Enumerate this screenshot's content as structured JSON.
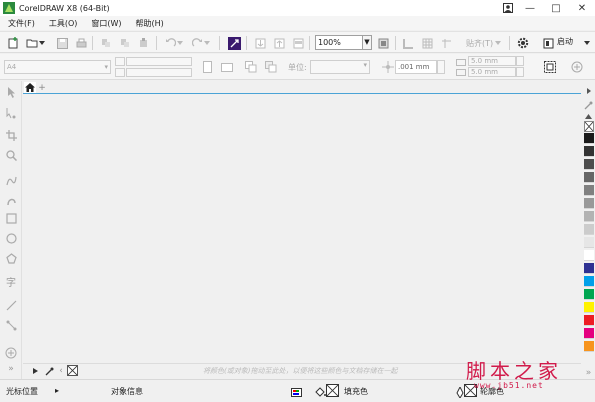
{
  "window": {
    "title": "CorelDRAW X8 (64-Bit)",
    "controls": [
      "minimize",
      "maximize",
      "close"
    ]
  },
  "menubar": {
    "items": [
      {
        "label": "文件(F)"
      },
      {
        "label": "工具(O)"
      },
      {
        "label": "窗口(W)"
      },
      {
        "label": "帮助(H)"
      }
    ]
  },
  "toolbar": {
    "zoom_value": "100%",
    "snap_label": "贴齐(T)",
    "launch_label": "启动"
  },
  "property_bar": {
    "paper_preset": "A4",
    "units_label": "单位:",
    "nudge_value": ".001 mm",
    "dup_x": "5.0 mm",
    "dup_y": "5.0 mm"
  },
  "hint_bar": {
    "text": "将颜色(或对象)拖动至此处，以便将这些颜色与文档存储在一起"
  },
  "statusbar": {
    "cursor_label": "光标位置",
    "object_info_label": "对象信息",
    "fill_label": "填充色",
    "outline_label": "轮廓色"
  },
  "watermark": {
    "main": "脚本之家",
    "url": "www.jb51.net"
  },
  "palette": {
    "colors": [
      "#1a1a1a",
      "#333333",
      "#4d4d4d",
      "#666666",
      "#808080",
      "#999999",
      "#b3b3b3",
      "#cccccc",
      "#e6e6e6",
      "#ffffff",
      "#2e3192",
      "#00a0e9",
      "#00a651",
      "#fff200",
      "#ed1c24",
      "#e4007f",
      "#f7941d"
    ]
  }
}
